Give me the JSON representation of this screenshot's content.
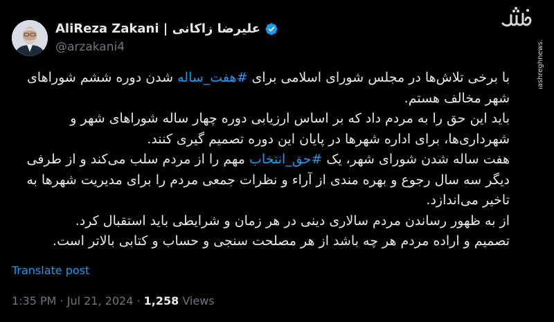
{
  "author": {
    "display_name": "AliReza Zakani | علیرضا زاکانی",
    "handle": "@arzakani4",
    "verified_icon": "verified-badge-icon",
    "verified_color": "#1d9bf0"
  },
  "tweet": {
    "lines": [
      {
        "segments": [
          {
            "text": "با برخی تلاش‌ها در مجلس شورای اسلامی برای ",
            "hashtag": false
          },
          {
            "text": "#هفت_ساله",
            "hashtag": true
          },
          {
            "text": " شدن دوره ششم شوراهای شهر مخالف هستم.",
            "hashtag": false
          }
        ]
      },
      {
        "segments": [
          {
            "text": "باید این حق را به مردم داد که بر اساس ارزیابی دوره چهار ساله شوراهای شهر و شهرداری‌ها، برای اداره شهرها در پایان این دوره تصمیم گیری کنند.",
            "hashtag": false
          }
        ]
      },
      {
        "segments": [
          {
            "text": "هفت ساله شدن شورای شهر، یک ",
            "hashtag": false
          },
          {
            "text": "#حق_انتخاب",
            "hashtag": true
          },
          {
            "text": " مهم را از مردم سلب می‌کند و از طرفی دیگر سه سال رجوع و بهره مندی از آراء و  نظرات جمعی مردم را برای مدیریت شهرها به تاخیر می‌اندازد.",
            "hashtag": false
          }
        ]
      },
      {
        "segments": [
          {
            "text": "از به ظهور رساندن مردم سالاری دینی در هر زمان و شرایطی باید استقبال کرد.",
            "hashtag": false
          }
        ]
      },
      {
        "segments": [
          {
            "text": "تصمیم و اراده مردم هر چه باشد از هر مصلحت سنجی و حساب و کتابی بالاتر است.",
            "hashtag": false
          }
        ]
      }
    ]
  },
  "translate_label": "Translate post",
  "meta": {
    "time": "1:35 PM",
    "separator": " · ",
    "date": "Jul 21, 2024",
    "views_count": "1,258",
    "views_label": " Views"
  },
  "watermark": {
    "logo_text": "مشرق",
    "url": "mashreghnews.ir"
  },
  "colors": {
    "background": "#000000",
    "text": "#e7e9ea",
    "muted": "#71767b",
    "accent": "#1d9bf0"
  }
}
